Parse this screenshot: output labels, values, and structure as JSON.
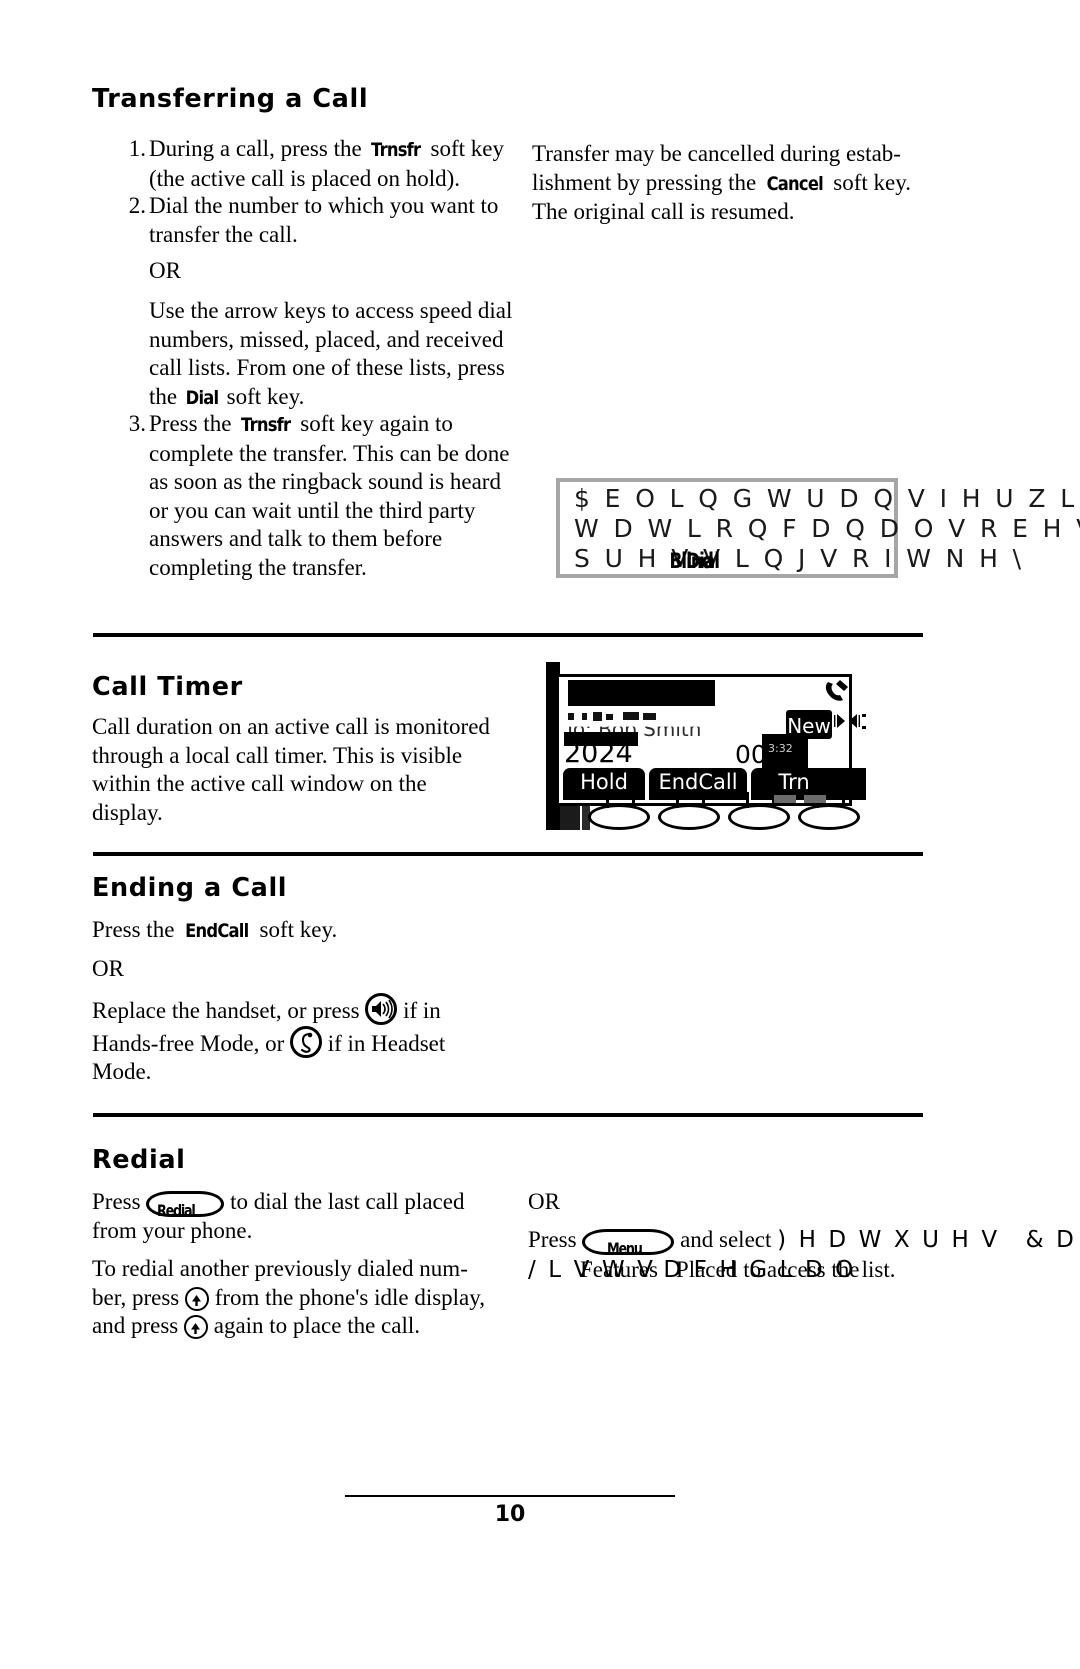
{
  "page": {
    "number": "10"
  },
  "sections": {
    "transferring": {
      "heading": "Transferring a Call",
      "steps": [
        {
          "num": "1.",
          "pre": "During a call, press the ",
          "key": "Trnsfr",
          "post": " soft key (the active call is placed on hold)."
        },
        {
          "num": "2.",
          "pre": "Dial the number to which you want to transfer the call.",
          "key": "",
          "post": ""
        },
        {
          "num": "3.",
          "pre": "Press the ",
          "key": "Trnsfr",
          "post": " soft key again to complete the transfer.  This can be done as soon as the ringback sound is heard or you can wait until the third party answers and talk to them before completing the transfer."
        }
      ],
      "or_label": "OR",
      "alt_pre": "Use the arrow keys to access speed dial numbers, missed, placed, and received call lists.  From one of these lists, press the ",
      "alt_key": "Dial",
      "alt_post": " soft key.",
      "right_pre": "Transfer may be cancelled during estab-lishment by pressing the ",
      "right_key": "Cancel",
      "right_post": " soft key. The original call is resumed.",
      "right_line1": "Transfer may be cancelled during estab-",
      "right_line2_pre": "lishment by pressing the ",
      "right_line2_key": "Cancel",
      "right_line2_post": " soft key.",
      "right_line3": "The original call is resumed.",
      "note_box": {
        "line1": "$  E O L Q G   W U D Q V I H U   Z L W K",
        "line2": "W D W L R Q   F D Q   D O V R   E H   V",
        "line3": "S U H V V L Q J   V R I W   N H \\",
        "overlay1": "Blind",
        "overlay2": "Dial"
      }
    },
    "call_timer": {
      "heading": "Call Timer",
      "body": "Call duration on an active call is monitored through a local call timer.  This is visible within the active call window on the display.",
      "lcd": {
        "to_label": "To: Bob Smith",
        "extension": "2024",
        "timer": "00:0",
        "timer_overlay": "3:32",
        "new_label": "New",
        "softkeys": [
          "Hold",
          "EndCall",
          "Trn"
        ]
      }
    },
    "ending": {
      "heading": "Ending a Call",
      "line1_pre": "Press the ",
      "line1_key": "EndCall",
      "line1_post": " soft key.",
      "or_label": "OR",
      "line2_a": "Replace the handset, or press ",
      "line2_b": " if in Hands-free Mode, or ",
      "line2_c": " if in Headset Mode.",
      "speaker_icon": "speaker-icon",
      "headset_icon": "headset-icon"
    },
    "redial": {
      "heading": "Redial",
      "press_label": "Press ",
      "redial_key_label": "Redial",
      "press_post": " to dial the last call placed from your phone.",
      "para2_a": "To redial another previously dialed num-ber, press ",
      "para2_b": " from the phone's idle display, and press ",
      "para2_c": " again to place the call.",
      "para2_line1": "To redial another previously dialed num-",
      "para2_line2_a": "ber, press ",
      "para2_line2_b": " from the phone's idle display,",
      "para2_line3_a": "and press ",
      "para2_line3_b": " again to place the call.",
      "or_label": "OR",
      "right_press": "Press ",
      "menu_key_label": "Menu",
      "right_mid": " and select ",
      "right_cipher1": ") H D W X U H V",
      "right_cipher2": "& D",
      "right_cipher3": "/ L V W V",
      "right_overlay1": "Features",
      "right_overlay2": "Call",
      "right_cipher4": "D F H",
      "right_overlay3": "to access the",
      "right_cipher5": "G L D O",
      "right_overlay4": "Placed",
      "right_tail": " list.",
      "right_line2_full": "/ L V W V   W R   D F H   G L D O   O L V W.",
      "right_overlay_line2": "Lists    Placed  to access the  list."
    }
  },
  "icons": {
    "speaker": "speaker-icon",
    "headset": "headset-icon",
    "up_arrow": "up-arrow-icon",
    "handset": "handset-icon",
    "volume": "volume-icon"
  },
  "colors": {
    "text": "#000000",
    "note_border": "#a6a6a6",
    "lcd_dark": "#000000"
  }
}
